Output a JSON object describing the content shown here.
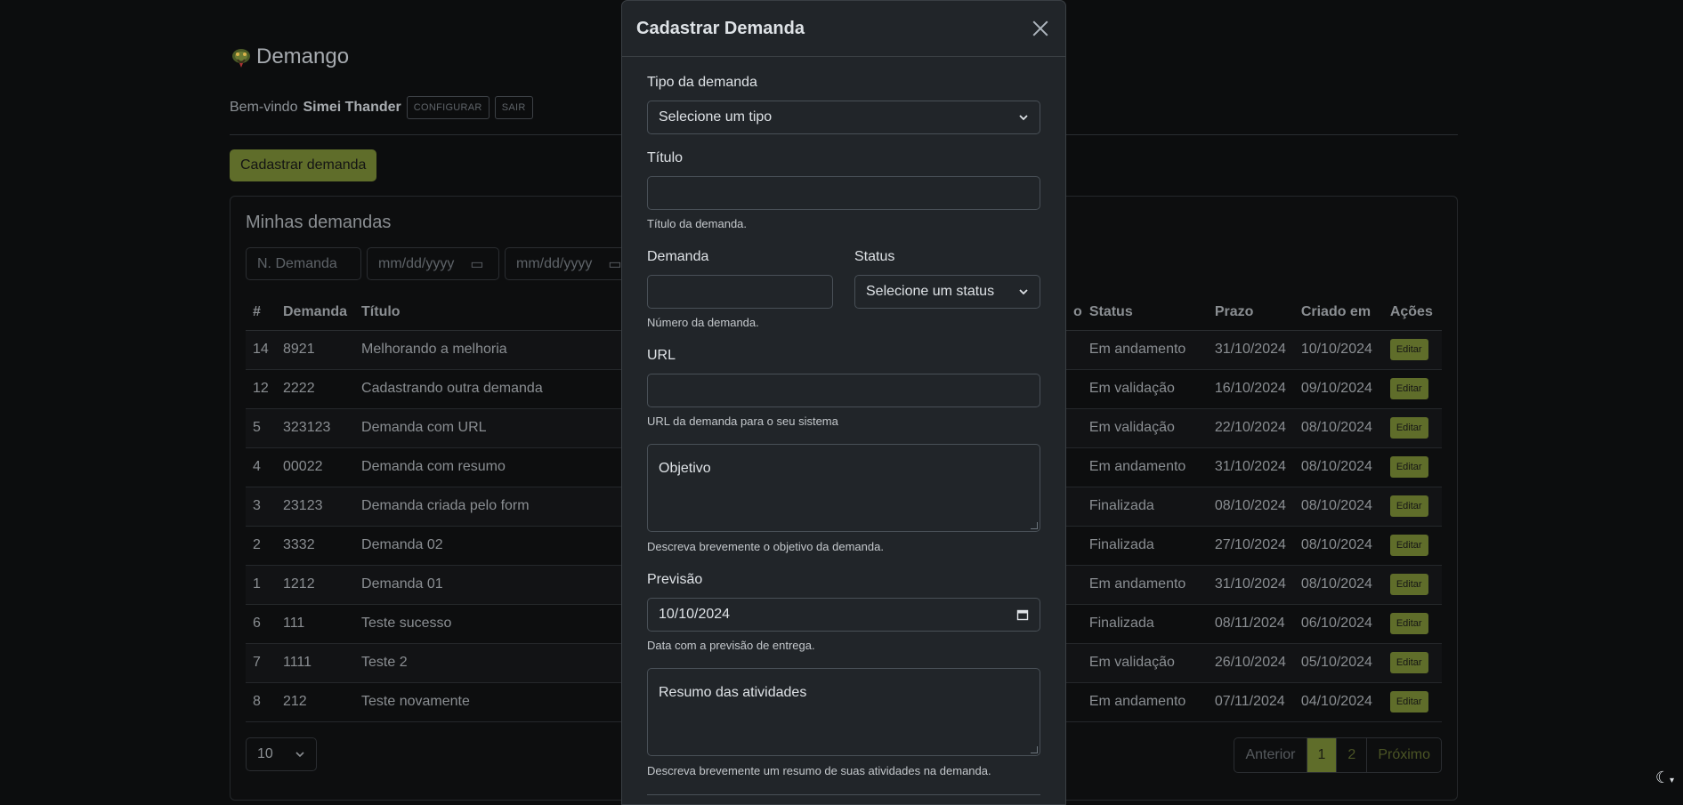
{
  "brand": {
    "name": "Demango"
  },
  "welcome": {
    "prefix": "Bem-vindo",
    "user": "Simei Thander",
    "configure": "CONFIGURAR",
    "logout": "SAIR"
  },
  "actions": {
    "register": "Cadastrar demanda"
  },
  "list": {
    "title": "Minhas demandas",
    "filters": {
      "number_placeholder": "N. Demanda",
      "date1": "mm/dd/yyyy",
      "date2": "mm/dd/yyyy"
    },
    "columns": [
      "#",
      "Demanda",
      "Título",
      "o",
      "Status",
      "Prazo",
      "Criado em",
      "Ações"
    ],
    "rows": [
      {
        "id": "14",
        "num": "8921",
        "title": "Melhorando a melhoria",
        "status": "Em andamento",
        "deadline": "31/10/2024",
        "created": "10/10/2024"
      },
      {
        "id": "12",
        "num": "2222",
        "title": "Cadastrando outra demanda",
        "status": "Em validação",
        "deadline": "16/10/2024",
        "created": "09/10/2024"
      },
      {
        "id": "5",
        "num": "323123",
        "title": "Demanda com URL",
        "status": "Em validação",
        "deadline": "22/10/2024",
        "created": "08/10/2024"
      },
      {
        "id": "4",
        "num": "00022",
        "title": "Demanda com resumo",
        "status": "Em andamento",
        "deadline": "31/10/2024",
        "created": "08/10/2024"
      },
      {
        "id": "3",
        "num": "23123",
        "title": "Demanda criada pelo form",
        "status": "Finalizada",
        "deadline": "08/10/2024",
        "created": "08/10/2024"
      },
      {
        "id": "2",
        "num": "3332",
        "title": "Demanda 02",
        "status": "Finalizada",
        "deadline": "27/10/2024",
        "created": "08/10/2024"
      },
      {
        "id": "1",
        "num": "1212",
        "title": "Demanda 01",
        "status": "Em andamento",
        "deadline": "31/10/2024",
        "created": "08/10/2024"
      },
      {
        "id": "6",
        "num": "111",
        "title": "Teste sucesso",
        "status": "Finalizada",
        "deadline": "08/11/2024",
        "created": "06/10/2024"
      },
      {
        "id": "7",
        "num": "1111",
        "title": "Teste 2",
        "status": "Em validação",
        "deadline": "26/10/2024",
        "created": "05/10/2024"
      },
      {
        "id": "8",
        "num": "212",
        "title": "Teste novamente",
        "status": "Em andamento",
        "deadline": "07/11/2024",
        "created": "04/10/2024"
      }
    ],
    "edit_label": "Editar",
    "per_page": "10",
    "pager": {
      "prev": "Anterior",
      "pages": [
        "1",
        "2"
      ],
      "next": "Próximo",
      "current": "1"
    }
  },
  "modal": {
    "title": "Cadastrar Demanda",
    "type": {
      "label": "Tipo da demanda",
      "value": "Selecione um tipo"
    },
    "title_field": {
      "label": "Título",
      "value": "",
      "help": "Título da demanda."
    },
    "number": {
      "label": "Demanda",
      "value": "",
      "help": "Número da demanda."
    },
    "status": {
      "label": "Status",
      "value": "Selecione um status"
    },
    "url": {
      "label": "URL",
      "value": "",
      "help": "URL da demanda para o seu sistema"
    },
    "objective": {
      "placeholder": "Objetivo",
      "help": "Descreva brevemente o objetivo da demanda."
    },
    "forecast": {
      "label": "Previsão",
      "value": "10/10/2024",
      "help": "Data com a previsão de entrega."
    },
    "summary": {
      "placeholder": "Resumo das atividades",
      "help": "Descreva brevemente um resumo de suas atividades na demanda."
    }
  },
  "icons": {
    "logo": "snake-logo-icon",
    "theme": "moon-icon"
  },
  "colors": {
    "accent": "#5f6d2a",
    "modal_bg": "#212529",
    "page_bg": "#0c0d0e"
  }
}
